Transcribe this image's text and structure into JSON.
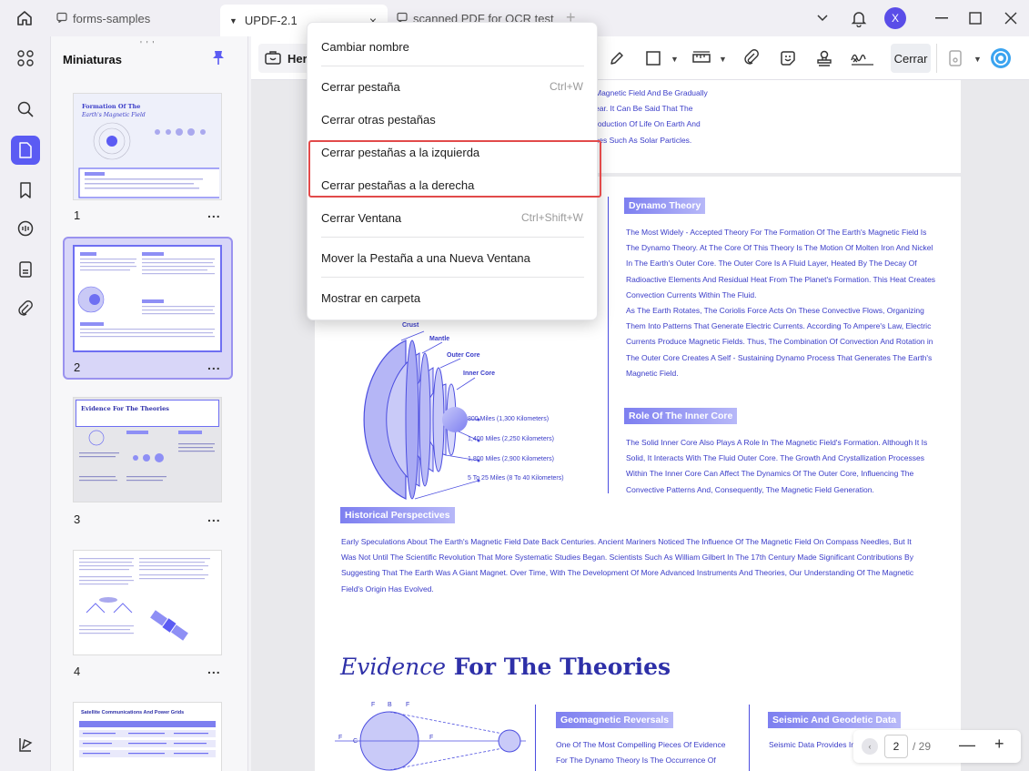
{
  "tabs": [
    {
      "label": "forms-samples"
    },
    {
      "label": "UPDF-2.1",
      "close": "×"
    },
    {
      "label": "scanned PDF for OCR test"
    }
  ],
  "new_tab": "+",
  "avatar_letter": "X",
  "sidebar": {
    "title": "Miniaturas",
    "grip": "' ' '",
    "thumbnails": [
      {
        "number": "1",
        "more": "...",
        "heading_line1": "Formation Of The",
        "heading_line2": "Earth's Magnetic Field"
      },
      {
        "number": "2",
        "more": "..."
      },
      {
        "number": "3",
        "more": "...",
        "heading_line1": "Evidence For The Theories"
      },
      {
        "number": "4",
        "more": "..."
      },
      {
        "heading_line1": "Satellite Communications And Power Grids"
      }
    ]
  },
  "toolbar": {
    "her_label": "Her",
    "cerrar_label": "Cerrar"
  },
  "context_menu": {
    "items": [
      {
        "label": "Cambiar nombre",
        "shortcut": ""
      },
      {
        "label": "Cerrar pestaña",
        "shortcut": "Ctrl+W"
      },
      {
        "label": "Cerrar otras pestañas",
        "shortcut": ""
      },
      {
        "label": "Cerrar pestañas a la izquierda",
        "shortcut": ""
      },
      {
        "label": "Cerrar pestañas a la derecha",
        "shortcut": ""
      },
      {
        "label": "Cerrar Ventana",
        "shortcut": "Ctrl+Shift+W"
      },
      {
        "label": "Mover la Pestaña a una Nueva Ventana",
        "shortcut": ""
      },
      {
        "label": "Mostrar en carpeta",
        "shortcut": ""
      }
    ]
  },
  "document": {
    "top_lines": [
      "Magnetic Field And Be Gradually",
      "ear. It Can Be Said That The",
      "roduction Of Life On Earth And",
      "ces Such As Solar Particles."
    ],
    "dynamo_title": "Dynamo Theory",
    "dynamo_lines": [
      "The Most Widely - Accepted Theory For The Formation Of The Earth's Magnetic Field Is",
      "The Dynamo Theory. At The Core Of This Theory Is The Motion Of Molten Iron And Nickel",
      "In The Earth's Outer Core. The Outer Core Is A Fluid Layer, Heated By The Decay Of",
      "Radioactive Elements And Residual Heat From The Planet's Formation. This Heat Creates",
      "Convection Currents Within The Fluid.",
      "As The Earth Rotates, The Coriolis Force Acts On These Convective Flows, Organizing",
      "Them Into Patterns That Generate Electric Currents. According To Ampere's Law, Electric",
      "Currents Produce Magnetic Fields. Thus, The Combination Of Convection And Rotation in",
      "The Outer Core Creates A Self - Sustaining Dynamo Process That Generates The Earth's",
      "Magnetic Field."
    ],
    "inner_core_title": "Role Of The Inner Core",
    "inner_core_lines": [
      "The Solid Inner Core Also Plays A Role In The Magnetic Field's Formation. Although It Is",
      "Solid, It Interacts With The Fluid Outer Core. The Growth And Crystallization Processes",
      "Within The Inner Core Can Affect The Dynamics Of The Outer Core, Influencing The",
      "Convective Patterns And, Consequently, The Magnetic Field Generation."
    ],
    "diagram": {
      "crust": "Crust",
      "mantle": "Mantle",
      "outer_core": "Outer Core",
      "inner_core": "Inner Core",
      "d1": "800 Miles (1,300 Kilometers)",
      "d2": "1,400 Miles (2,250 Kilometers)",
      "d3": "1,800 Miles (2,900 Kilometers)",
      "d4": "5 To 25 Miles (8 To 40 Kilometers)"
    },
    "historical_title": "Historical Perspectives",
    "historical_lines": [
      "Early Speculations About The Earth's Magnetic Field Date Back Centuries. Ancient Mariners Noticed The Influence Of The Magnetic Field On Compass Needles, But It",
      "Was Not Until The Scientific Revolution That More Systematic Studies Began. Scientists Such As William Gilbert In The 17th Century Made Significant Contributions By",
      "Suggesting That The Earth Was A Giant Magnet. Over Time, With The Development Of More Advanced Instruments And Theories, Our Understanding Of The Magnetic",
      "Field's Origin Has Evolved."
    ],
    "evidence_italic": "Evidence",
    "evidence_bold": " For The Theories",
    "geomagnetic_title": "Geomagnetic Reversals",
    "geomagnetic_lines": [
      "One Of The Most Compelling Pieces Of Evidence",
      "For The Dynamo Theory Is The Occurrence Of"
    ],
    "seismic_title": "Seismic And Geodetic Data",
    "seismic_lines": [
      "Seismic Data Provides Insig"
    ]
  },
  "pager": {
    "prev": "‹",
    "current": "2",
    "total": "/ 29",
    "zoom_out": "—",
    "zoom_in": "+"
  }
}
